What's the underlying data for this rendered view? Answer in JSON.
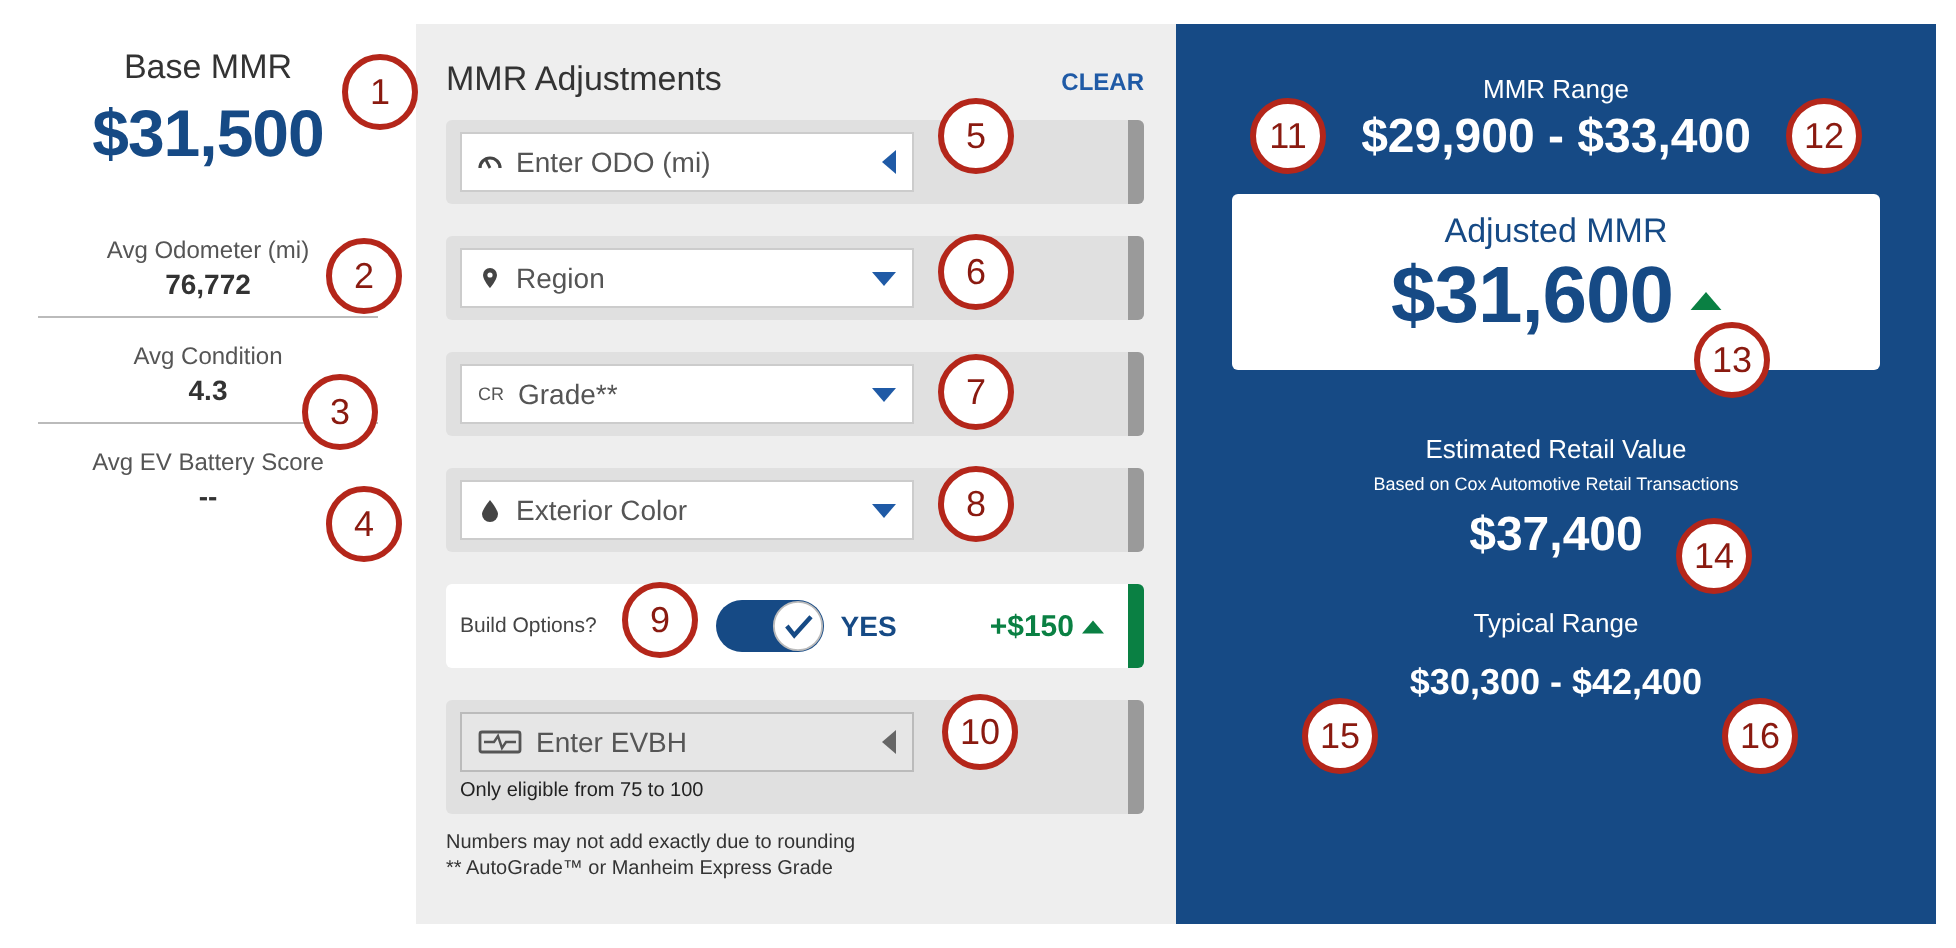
{
  "base": {
    "title": "Base MMR",
    "value": "$31,500"
  },
  "stats": [
    {
      "label": "Avg Odometer (mi)",
      "value": "76,772"
    },
    {
      "label": "Avg Condition",
      "value": "4.3"
    },
    {
      "label": "Avg EV Battery Score",
      "value": "--"
    }
  ],
  "adjustments": {
    "title": "MMR Adjustments",
    "clear": "CLEAR",
    "fields": [
      {
        "kind": "input",
        "placeholder": "Enter ODO (mi)",
        "disabled": false
      },
      {
        "kind": "select",
        "placeholder": "Region"
      },
      {
        "kind": "select",
        "placeholder": "Grade**",
        "icon_text": "CR"
      },
      {
        "kind": "select",
        "placeholder": "Exterior Color"
      },
      {
        "kind": "toggle",
        "label": "Build Options?",
        "on": true,
        "state_label": "YES",
        "delta": "+$150"
      },
      {
        "kind": "input",
        "placeholder": "Enter EVBH",
        "disabled": true,
        "note": "Only eligible from 75 to 100"
      }
    ],
    "footnotes": [
      "Numbers may not add exactly due to rounding",
      "** AutoGrade™ or Manheim Express Grade"
    ]
  },
  "summary": {
    "range_title": "MMR Range",
    "range": "$29,900 - $33,400",
    "adjusted_title": "Adjusted MMR",
    "adjusted": "$31,600",
    "retail_title": "Estimated Retail Value",
    "retail_sub": "Based on Cox Automotive Retail Transactions",
    "retail": "$37,400",
    "typical_title": "Typical Range",
    "typical": "$30,300 - $42,400"
  },
  "callouts": [
    "1",
    "2",
    "3",
    "4",
    "5",
    "6",
    "7",
    "8",
    "9",
    "10",
    "11",
    "12",
    "13",
    "14",
    "15",
    "16"
  ]
}
